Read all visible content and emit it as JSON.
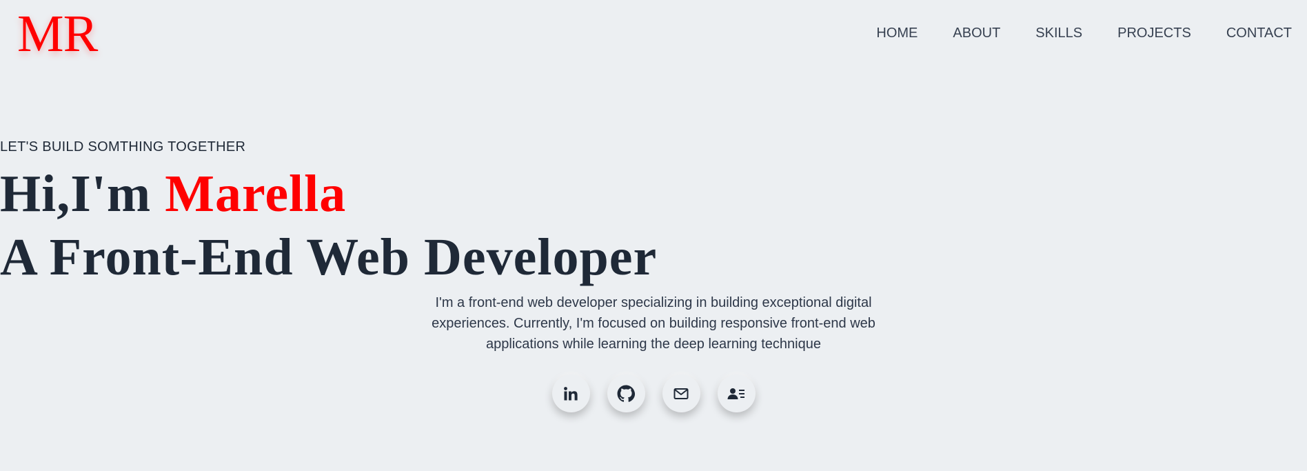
{
  "header": {
    "logo_text": "MR",
    "nav": [
      {
        "label": "HOME"
      },
      {
        "label": "ABOUT"
      },
      {
        "label": "SKILLS"
      },
      {
        "label": "PROJECTS"
      },
      {
        "label": "CONTACT"
      }
    ]
  },
  "hero": {
    "tagline": "LET'S BUILD SOMTHING TOGETHER",
    "greeting_prefix": "Hi,I'm ",
    "name": "Marella",
    "role": "A Front-End Web Developer",
    "bio": "I'm a front-end web developer specializing in building exceptional digital experiences. Currently, I'm focused on building responsive front-end web applications while learning the deep learning technique"
  },
  "socials": [
    {
      "icon": "linkedin-icon"
    },
    {
      "icon": "github-icon"
    },
    {
      "icon": "mail-icon"
    },
    {
      "icon": "contact-card-icon"
    }
  ],
  "colors": {
    "accent": "#ff0000",
    "text": "#1f2937",
    "background": "#eceff2"
  }
}
